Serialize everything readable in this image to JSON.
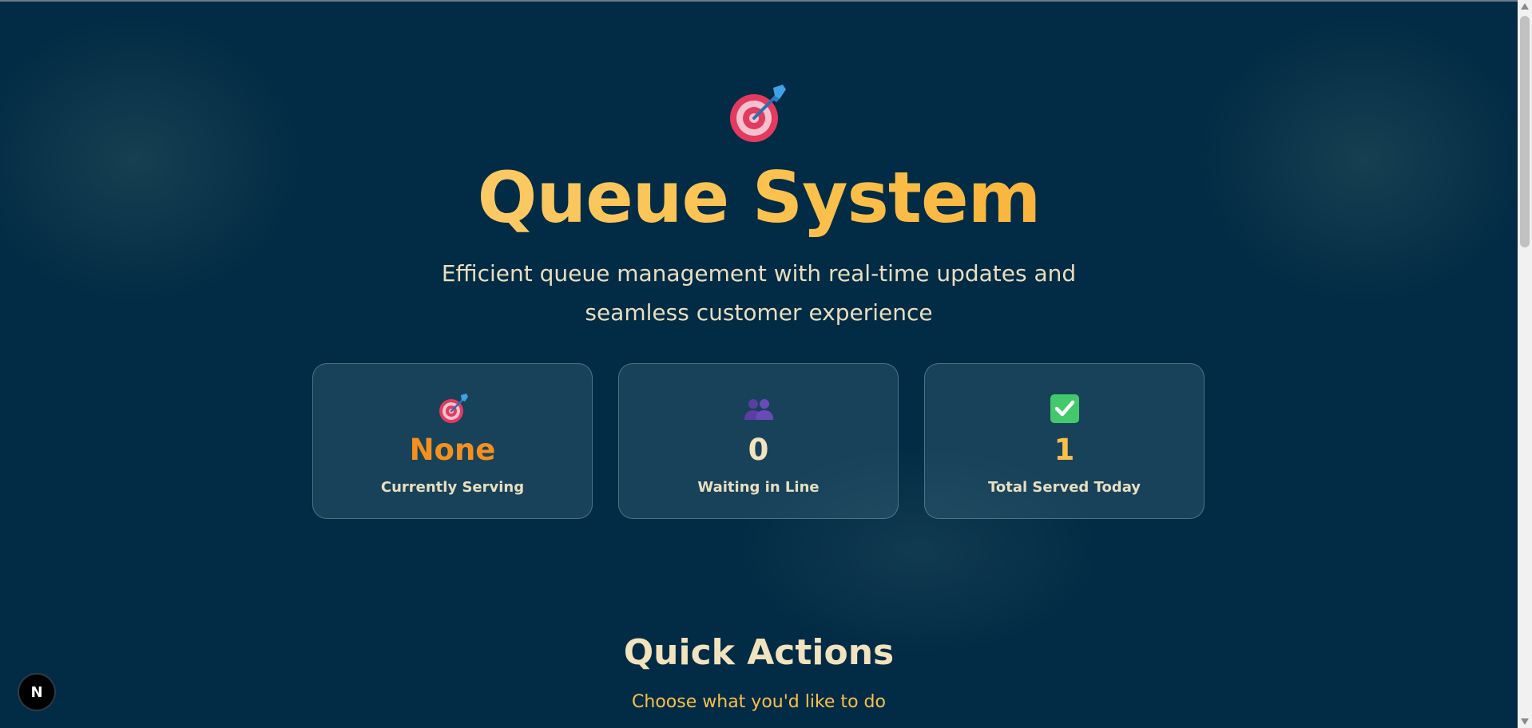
{
  "hero": {
    "icon": "target-dart-icon",
    "title": "Queue System",
    "subtitle": "Efficient queue management with real-time updates and seamless customer experience"
  },
  "stats": [
    {
      "icon": "target-dart-icon",
      "value": "None",
      "label": "Currently Serving",
      "value_color": "#f5901e"
    },
    {
      "icon": "people-icon",
      "value": "0",
      "label": "Waiting in Line",
      "value_color": "#f1e3bd"
    },
    {
      "icon": "check-box-icon",
      "value": "1",
      "label": "Total Served Today",
      "value_color": "#fbc04a"
    }
  ],
  "quick_actions": {
    "title": "Quick Actions",
    "subtitle": "Choose what you'd like to do"
  },
  "badge": {
    "letter": "N",
    "icon": "nextjs-devtools-icon"
  },
  "colors": {
    "background": "#022b45",
    "accent": "#fbc04a",
    "accent_orange": "#f5901e",
    "text": "#e9dfbf"
  }
}
